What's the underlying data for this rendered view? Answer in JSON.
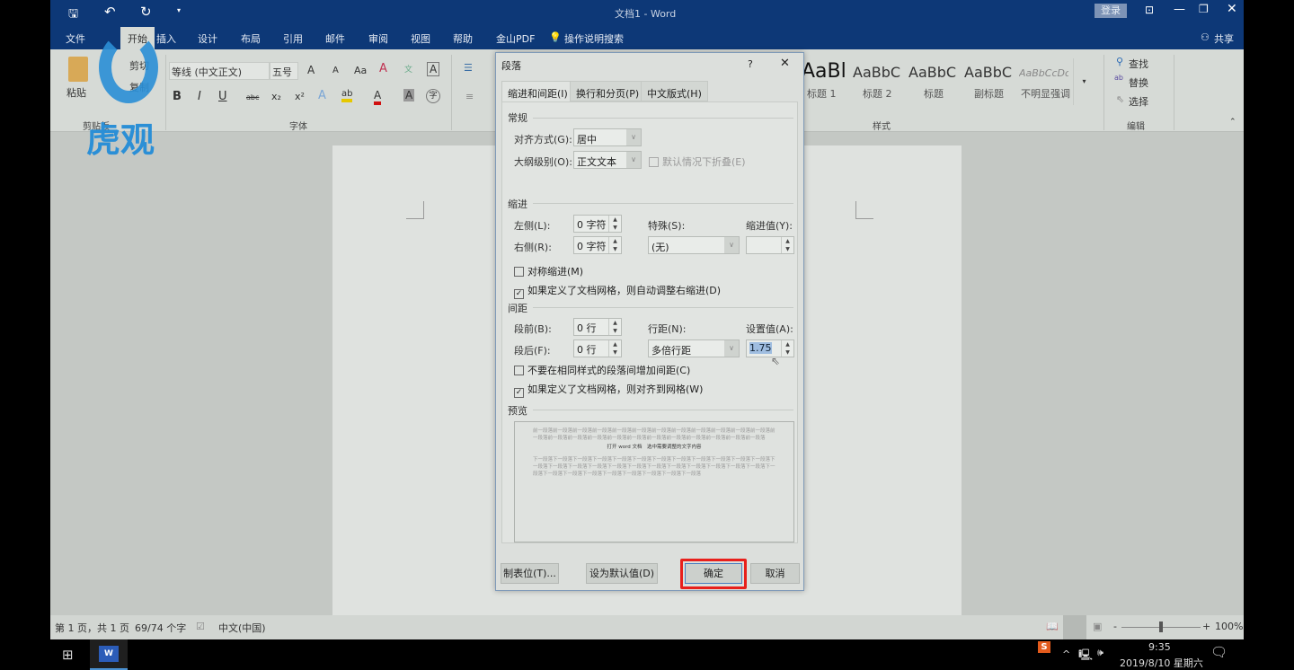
{
  "titlebar": {
    "title": "文档1 - Word",
    "login": "登录",
    "quick_access": [
      "save-icon",
      "undo-icon",
      "redo-icon",
      "customize-icon"
    ]
  },
  "menu": {
    "items": [
      "文件",
      "开始",
      "插入",
      "设计",
      "布局",
      "引用",
      "邮件",
      "审阅",
      "视图",
      "帮助",
      "金山PDF"
    ],
    "search": "操作说明搜索",
    "share": "共享"
  },
  "ribbon": {
    "clipboard": {
      "paste": "粘贴",
      "cut": "剪切",
      "copy": "复制",
      "group": "剪贴板"
    },
    "font": {
      "name": "等线 (中文正文)",
      "size": "五号",
      "group": "字体",
      "buttons": [
        "B",
        "I",
        "U",
        "abc",
        "x₂",
        "x²"
      ]
    },
    "styles": {
      "items": [
        {
          "sample": "AaBl",
          "label": "标题 1"
        },
        {
          "sample": "AaBbC",
          "label": "标题 2"
        },
        {
          "sample": "AaBbC",
          "label": "标题"
        },
        {
          "sample": "AaBbC",
          "label": "副标题"
        },
        {
          "sample": "AaBbCcDc",
          "label": "不明显强调"
        }
      ],
      "group": "样式"
    },
    "editing": {
      "find": "查找",
      "replace": "替换",
      "select": "选择",
      "group": "编辑"
    }
  },
  "dialog": {
    "title": "段落",
    "help": "?",
    "tabs": [
      "缩进和间距(I)",
      "换行和分页(P)",
      "中文版式(H)"
    ],
    "general": {
      "heading": "常规",
      "alignment_label": "对齐方式(G):",
      "alignment": "居中",
      "outline_label": "大纲级别(O):",
      "outline": "正文文本",
      "collapse": "默认情况下折叠(E)"
    },
    "indent": {
      "heading": "缩进",
      "left_label": "左侧(L):",
      "left": "0 字符",
      "right_label": "右侧(R):",
      "right": "0 字符",
      "special_label": "特殊(S):",
      "special": "(无)",
      "by_label": "缩进值(Y):",
      "by": "",
      "mirror": "对称缩进(M)",
      "auto_adjust": "如果定义了文档网格，则自动调整右缩进(D)"
    },
    "spacing": {
      "heading": "间距",
      "before_label": "段前(B):",
      "before": "0 行",
      "after_label": "段后(F):",
      "after": "0 行",
      "line_label": "行距(N):",
      "line": "多倍行距",
      "at_label": "设置值(A):",
      "at": "1.75",
      "no_space": "不要在相同样式的段落间增加间距(C)",
      "snap": "如果定义了文档网格，则对齐到网格(W)"
    },
    "preview": {
      "heading": "预览",
      "prev": "前一段落前一段落前一段落前一段落前一段落前一段落前一段落前一段落前一段落前一段落前一段落前一段落前一段落前一段落前一段落前一段落前一段落前一段落前一段落前一段落前一段落前一段落前一段落前一段落",
      "current": "打开 word 文档　选中需要调整的文字内容",
      "next": "下一段落下一段落下一段落下一段落下一段落下一段落下一段落下一段落下一段落下一段落下一段落下一段落下一段落下一段落下一段落下一段落下一段落下一段落下一段落下一段落下一段落下一段落下一段落下一段落下一段落下一段落下一段落下一段落下一段落下一段落下一段落下一段落下一段落"
    },
    "buttons": {
      "tabs": "制表位(T)...",
      "default": "设为默认值(D)",
      "ok": "确定",
      "cancel": "取消"
    },
    "highlight_color": "#e8201c"
  },
  "status": {
    "page": "第 1 页，共 1 页",
    "words": "69/74 个字",
    "language": "中文(中国)",
    "zoom": "100%",
    "zoom_minus": "-",
    "zoom_plus": "+"
  },
  "taskbar": {
    "time": "9:35",
    "date": "2019/8/10 星期六"
  },
  "watermark": {
    "text": "虎观"
  }
}
